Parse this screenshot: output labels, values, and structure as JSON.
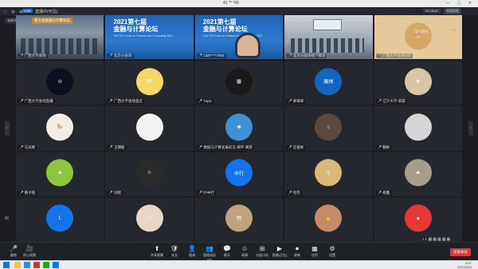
{
  "window": {
    "title": "41 ** *40"
  },
  "infobar": {
    "live_tag": "LIVE",
    "live_text": "直播中(可见)",
    "time": "01:18:40",
    "view_button": "宫格视图"
  },
  "recording_badge": "录制中",
  "conference": {
    "banner": "第七届金融与计算论坛",
    "title_line1": "2021第七届",
    "title_line2": "金融与计算论坛",
    "subtitle": "The 7th Forum on Finance and Computing 2021"
  },
  "tiles": [
    {
      "name": "广西大学会场",
      "kind": "video1"
    },
    {
      "name": "北京分会场",
      "kind": "video2"
    },
    {
      "name": "138*****7804",
      "kind": "video3"
    },
    {
      "name": "北京分会场线下情况",
      "kind": "video4"
    },
    {
      "name": "广西大学会场同步",
      "kind": "doge"
    },
    {
      "name": "广西大学会场直播",
      "kind": "avatar",
      "color": "#0c1020",
      "glyph": "◎"
    },
    {
      "name": "广西大学会场直云",
      "kind": "avatar",
      "color": "#f4d86a",
      "glyph": "64"
    },
    {
      "name": "Topic",
      "kind": "avatar",
      "color": "#1a1a1a",
      "glyph": "▦"
    },
    {
      "name": "帅锋锋",
      "kind": "avatar",
      "color": "#1565c0",
      "glyph": "腾帅"
    },
    {
      "name": "辽宁大学-宋骐",
      "kind": "avatar",
      "color": "#d8c4a8",
      "glyph": "❀"
    },
    {
      "name": "马光继",
      "kind": "avatar",
      "color": "#f1ede6",
      "glyph": "🐎"
    },
    {
      "name": "王朗聪",
      "kind": "avatar",
      "color": "#f3f3f3",
      "glyph": "✈"
    },
    {
      "name": "数据与计算发展前沿-黄怀-黄凯",
      "kind": "avatar",
      "color": "#3d8fd6",
      "glyph": "◉"
    },
    {
      "name": "应富彬",
      "kind": "avatar",
      "color": "#5b4a3e",
      "glyph": "⌂"
    },
    {
      "name": "魏彬",
      "kind": "avatar",
      "color": "#d5d5d5",
      "glyph": ""
    },
    {
      "name": "韩子铭",
      "kind": "avatar",
      "color": "#8dc53e",
      "glyph": "☘"
    },
    {
      "name": "刘昭",
      "kind": "avatar",
      "color": "#2a2a2a",
      "glyph": "☺"
    },
    {
      "name": "叶中行",
      "kind": "avatar",
      "color": "#1473e6",
      "glyph": "中行"
    },
    {
      "name": "何杰",
      "kind": "avatar",
      "color": "#d9b77a",
      "glyph": "⚲"
    },
    {
      "name": "杨鑫",
      "kind": "avatar",
      "color": "#a89c8c",
      "glyph": "⛰"
    },
    {
      "name": "",
      "kind": "avatar",
      "color": "#1473e6",
      "glyph": "L"
    },
    {
      "name": "",
      "kind": "avatar",
      "color": "#e8d6c6",
      "glyph": "☺"
    },
    {
      "name": "",
      "kind": "avatar",
      "color": "#c1a27e",
      "glyph": "⛩"
    },
    {
      "name": "",
      "kind": "avatar",
      "color": "#c98a6a",
      "glyph": "🍐"
    },
    {
      "name": "",
      "kind": "avatar",
      "color": "#e53935",
      "glyph": "★"
    }
  ],
  "top_right_panel": {
    "name": "正在讲话"
  },
  "toolbar": {
    "items": [
      {
        "label": "解除",
        "icon": "mic-icon",
        "glyph": "🎤",
        "red": true
      },
      {
        "label": "停止视频",
        "icon": "camera-icon",
        "glyph": "🎥",
        "red": false
      },
      {
        "label": "共享屏幕",
        "icon": "share-screen-icon",
        "glyph": "⬆",
        "red": false
      },
      {
        "label": "安全",
        "icon": "shield-icon",
        "glyph": "🛡",
        "red": false
      },
      {
        "label": "邀请",
        "icon": "invite-icon",
        "glyph": "👤",
        "red": false
      },
      {
        "label": "管理成员(45)",
        "icon": "members-icon",
        "glyph": "👥",
        "red": false
      },
      {
        "label": "聊天",
        "icon": "chat-icon",
        "glyph": "💬",
        "red": false
      },
      {
        "label": "表情",
        "icon": "emoji-icon",
        "glyph": "☺",
        "red": false
      },
      {
        "label": "分组讨论",
        "icon": "breakout-icon",
        "glyph": "⊞",
        "red": false
      },
      {
        "label": "直播(正在)",
        "icon": "live-icon",
        "glyph": "▶",
        "red": false
      },
      {
        "label": "录制",
        "icon": "record-icon",
        "glyph": "⏺",
        "red": false
      },
      {
        "label": "应用",
        "icon": "apps-icon",
        "glyph": "▦",
        "red": false
      },
      {
        "label": "设置",
        "icon": "gear-icon",
        "glyph": "⚙",
        "red": false
      }
    ],
    "leave_label": "结束会议"
  },
  "taskbar": {
    "time": "8:57",
    "date": "2021/6/19"
  }
}
